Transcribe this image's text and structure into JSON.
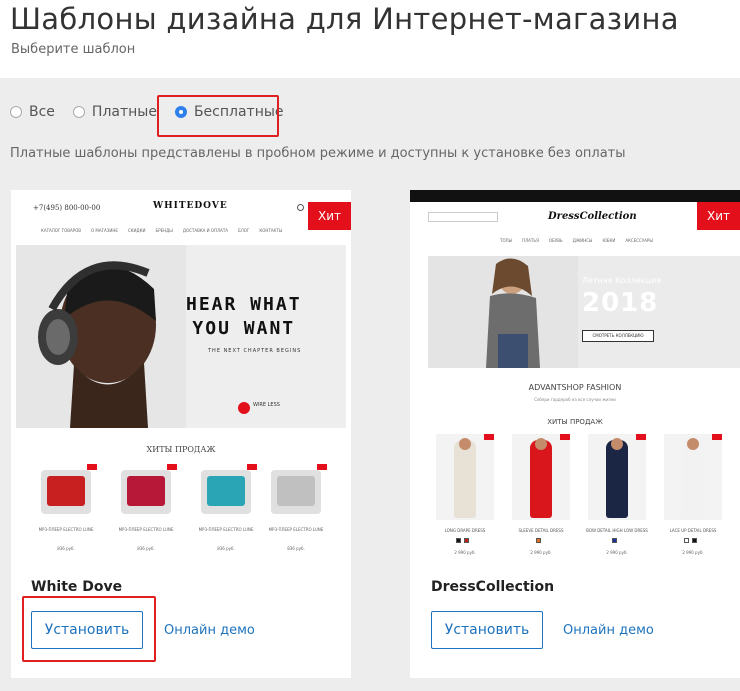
{
  "header": {
    "title": "Шаблоны дизайна для Интернет-магазина",
    "subtitle": "Выберите шаблон"
  },
  "filters": {
    "options": [
      {
        "label": "Все",
        "selected": false
      },
      {
        "label": "Платные",
        "selected": false
      },
      {
        "label": "Бесплатные",
        "selected": true
      }
    ]
  },
  "notice": "Платные шаблоны представлены в пробном режиме и доступны к установке без оплаты",
  "templates": [
    {
      "name": "White Dove",
      "badge": "Хит",
      "install_label": "Установить",
      "demo_label": "Онлайн демо",
      "preview": {
        "phone": "+7(495) 800-00-00",
        "logo": "WHITEDOVE",
        "nav": [
          "КАТАЛОГ ТОВАРОВ",
          "О МАГАЗИНЕ",
          "СКИДКИ",
          "БРЕНДЫ",
          "ДОСТАВКА И ОПЛАТА",
          "БЛОГ",
          "КОНТАКТЫ"
        ],
        "headline_1": "HEAR WHAT",
        "headline_2": "YOU WANT",
        "tagline": "THE NEXT CHAPTER BEGINS",
        "brand_small": "WIRE LESS",
        "section": "ХИТЫ ПРОДАЖ",
        "products": [
          {
            "text": "MP3-ПЛЕЕР ELECTRO LUNE",
            "price": "836 руб.",
            "color": "#c82020"
          },
          {
            "text": "MP3-ПЛЕЕР ELECTRO LUNE",
            "price": "836 руб.",
            "color": "#b81838"
          },
          {
            "text": "MP3-ПЛЕЕР ELECTRO LUNE",
            "price": "836 руб.",
            "color": "#2aa5b5"
          },
          {
            "text": "MP3-ПЛЕЕР ELECTRO LUNE",
            "price": "836 руб.",
            "color": "#c0c0c0"
          }
        ]
      }
    },
    {
      "name": "DressCollection",
      "badge": "Хит",
      "install_label": "Установить",
      "demo_label": "Онлайн демо",
      "preview": {
        "logo": "DressCollection",
        "nav": [
          "ТОПЫ",
          "ПЛАТЬЯ",
          "ОБУВЬ",
          "ДЖИНСЫ",
          "ЮБКИ",
          "АКСЕССУАРЫ"
        ],
        "hero_title": "Летняя Коллекция",
        "hero_year": "2018",
        "hero_button": "СМОТРЕТЬ КОЛЛЕКЦИЮ",
        "brand": "ADVANTSHOP FASHION",
        "brand_sub": "Собери гардероб на все случаи жизни",
        "section": "ХИТЫ ПРОДАЖ",
        "products": [
          {
            "name": "LONG DRAPE DRESS",
            "price": "2 990 руб.",
            "color": "#e8e2d6"
          },
          {
            "name": "SLEEVE DETAIL DRESS",
            "price": "2 990 руб.",
            "color": "#d8161c"
          },
          {
            "name": "BOW DETAIL HIGH LOW DRESS",
            "price": "2 990 руб.",
            "color": "#1b2645"
          },
          {
            "name": "LACE UP DETAIL DRESS",
            "price": "2 990 руб.",
            "color": "#f2f2f2"
          }
        ]
      }
    }
  ]
}
